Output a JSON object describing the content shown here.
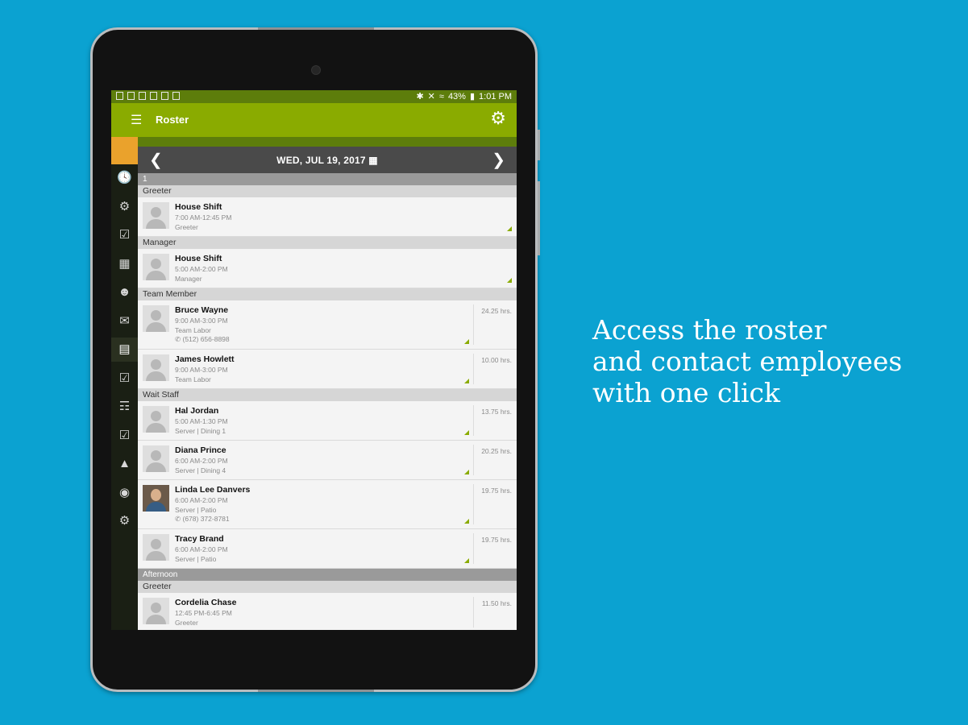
{
  "status_bar": {
    "battery": "43%",
    "time": "1:01 PM",
    "icons_left": [
      "person-icon",
      "image-icon",
      "clipboard-icon",
      "photo-icon",
      "grid-icon",
      "play-store-icon"
    ],
    "icons_right": [
      "bluetooth-icon",
      "mute-icon",
      "wifi-icon",
      "battery-icon"
    ]
  },
  "app_bar": {
    "title": "Roster",
    "menu_icon": "menu-icon",
    "settings_icon": "gear-icon"
  },
  "date_bar": {
    "date": "WED, JUL 19, 2017",
    "prev_icon": "chevron-left-icon",
    "next_icon": "chevron-right-icon",
    "calendar_icon": "calendar-icon"
  },
  "nav_rail": [
    "clock-icon",
    "gear-cog-icon",
    "calendar-check-icon",
    "calendar-icon",
    "person-icon",
    "mail-icon",
    "document-icon",
    "checkbox-icon",
    "book-icon",
    "calendar-check-icon",
    "chart-icon",
    "graduation-cap-icon",
    "settings-icon"
  ],
  "shifts": [
    {
      "label": "1",
      "roles": [
        {
          "role": "Greeter",
          "rows": [
            {
              "name": "House Shift",
              "time": "7:00 AM-12:45 PM",
              "detail": "Greeter"
            }
          ]
        },
        {
          "role": "Manager",
          "rows": [
            {
              "name": "House Shift",
              "time": "5:00 AM-2:00 PM",
              "detail": "Manager"
            }
          ]
        },
        {
          "role": "Team Member",
          "rows": [
            {
              "name": "Bruce Wayne",
              "time": "9:00 AM-3:00 PM",
              "detail": "Team Labor",
              "phone": "(512) 656-8898",
              "hours": "24.25 hrs."
            },
            {
              "name": "James Howlett",
              "time": "9:00 AM-3:00 PM",
              "detail": "Team Labor",
              "hours": "10.00 hrs."
            }
          ]
        },
        {
          "role": "Wait Staff",
          "rows": [
            {
              "name": "Hal Jordan",
              "time": "5:00 AM-1:30 PM",
              "detail": "Server | Dining 1",
              "hours": "13.75 hrs."
            },
            {
              "name": "Diana Prince",
              "time": "6:00 AM-2:00 PM",
              "detail": "Server | Dining 4",
              "hours": "20.25 hrs."
            },
            {
              "name": "Linda Lee Danvers",
              "time": "6:00 AM-2:00 PM",
              "detail": "Server | Patio",
              "phone": "(678) 372-8781",
              "hours": "19.75 hrs.",
              "photo": true
            },
            {
              "name": "Tracy Brand",
              "time": "6:00 AM-2:00 PM",
              "detail": "Server | Patio",
              "hours": "19.75 hrs."
            }
          ]
        }
      ]
    },
    {
      "label": "Afternoon",
      "roles": [
        {
          "role": "Greeter",
          "rows": [
            {
              "name": "Cordelia Chase",
              "time": "12:45 PM-6:45 PM",
              "detail": "Greeter",
              "hours": "11.50 hrs."
            }
          ]
        }
      ]
    }
  ],
  "caption": {
    "line1": "Access the roster",
    "line2": "and contact employees",
    "line3": "with one click"
  }
}
